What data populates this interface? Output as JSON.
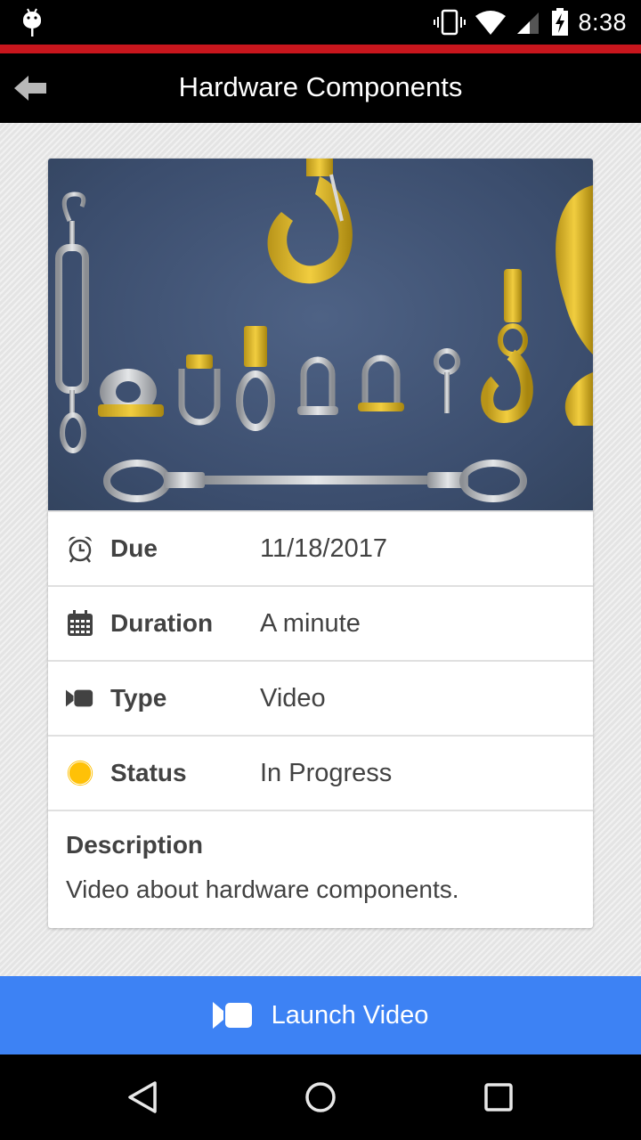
{
  "status_bar": {
    "time": "8:38",
    "icons": [
      "android-debug-icon",
      "vibrate-icon",
      "wifi-icon",
      "cell-signal-icon",
      "battery-charging-icon"
    ]
  },
  "app_bar": {
    "title": "Hardware Components",
    "back_icon": "back-arrow-icon"
  },
  "card": {
    "image_alt": "Rigging hardware: turnbuckle, hooks, shackles, eye bolt, wire rope sling",
    "details": [
      {
        "icon": "alarm-clock-icon",
        "label": "Due",
        "value": "11/18/2017"
      },
      {
        "icon": "calendar-icon",
        "label": "Duration",
        "value": "A minute"
      },
      {
        "icon": "video-camera-icon",
        "label": "Type",
        "value": "Video"
      },
      {
        "icon": "status-dot-icon",
        "label": "Status",
        "value": "In Progress",
        "status_color": "#ffc107"
      }
    ],
    "description": {
      "heading": "Description",
      "text": "Video about hardware components."
    }
  },
  "launch_button": {
    "label": "Launch Video",
    "icon": "video-camera-icon",
    "color": "#3d82f4"
  },
  "nav_bar": {
    "buttons": [
      "back-nav-icon",
      "home-nav-icon",
      "recents-nav-icon"
    ]
  },
  "colors": {
    "accent_line": "#c8161d",
    "text": "#424242"
  }
}
